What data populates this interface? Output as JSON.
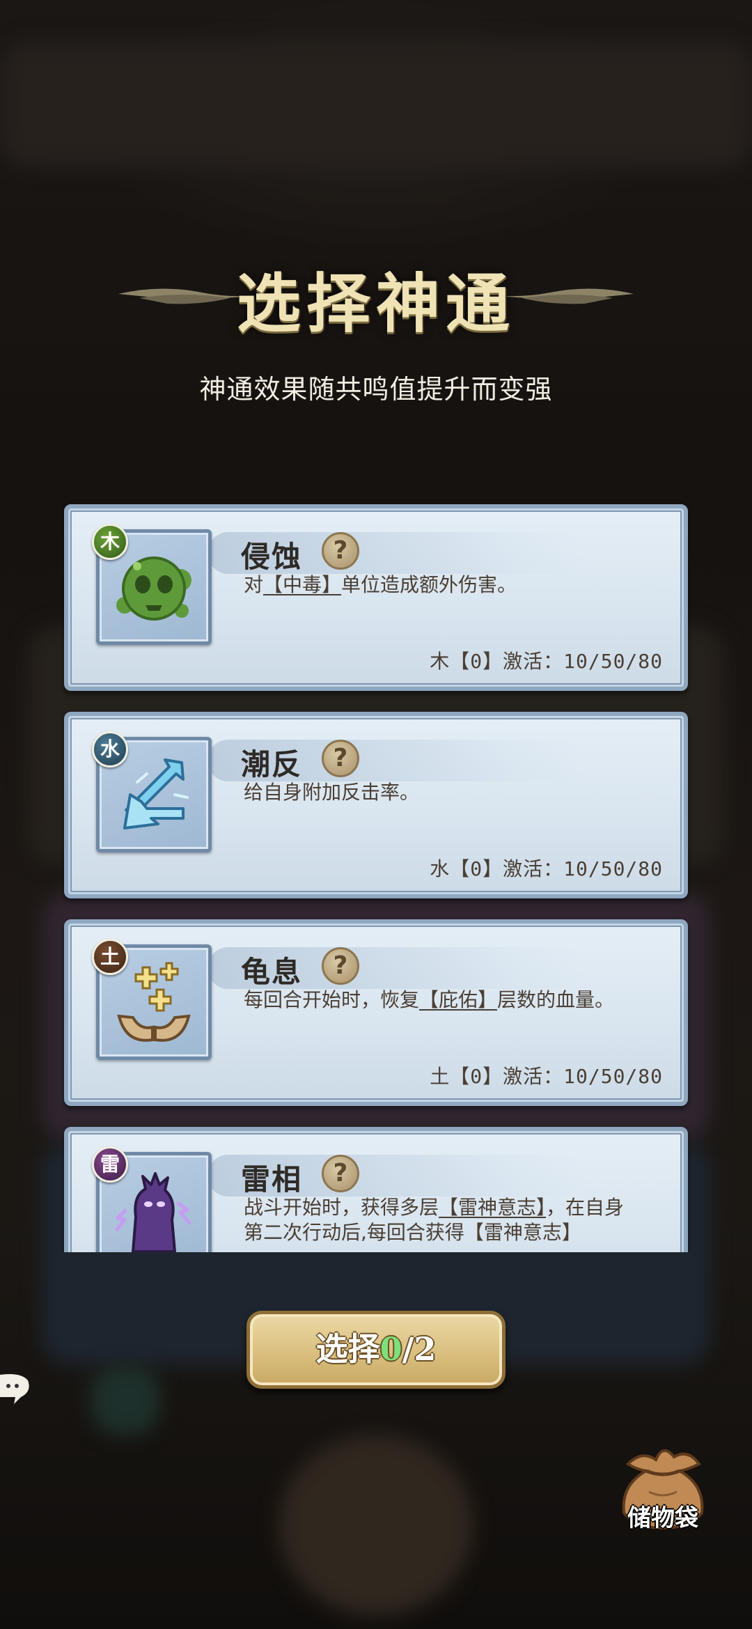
{
  "title": "选择神通",
  "subtitle": "神通效果随共鸣值提升而变强",
  "cards": [
    {
      "element": "木",
      "icon": "poison-skull-icon",
      "name": "侵蚀",
      "desc_prefix": "对",
      "desc_keyword": "【中毒】",
      "desc_suffix": "单位造成额外伤害。",
      "activation": "木【0】激活：10/50/80"
    },
    {
      "element": "水",
      "icon": "counter-arrow-icon",
      "name": "潮反",
      "desc_prefix": "给自身附加反击率。",
      "desc_keyword": "",
      "desc_suffix": "",
      "activation": "水【0】激活：10/50/80"
    },
    {
      "element": "土",
      "icon": "healing-hands-icon",
      "name": "龟息",
      "desc_prefix": "每回合开始时，恢复",
      "desc_keyword": "【庇佑】",
      "desc_suffix": "层数的血量。",
      "activation": "土【0】激活：10/50/80"
    },
    {
      "element": "雷",
      "icon": "thunder-spirit-icon",
      "name": "雷相",
      "desc_prefix": "战斗开始时，获得多层",
      "desc_keyword": "【雷神意志】",
      "desc_suffix": "，在自身第二次行动后,每回合获得【雷神意志】",
      "activation": ""
    }
  ],
  "help_symbol": "?",
  "select_button": {
    "label": "选择",
    "count": "0",
    "total": "/2"
  },
  "bag_label": "储物袋"
}
